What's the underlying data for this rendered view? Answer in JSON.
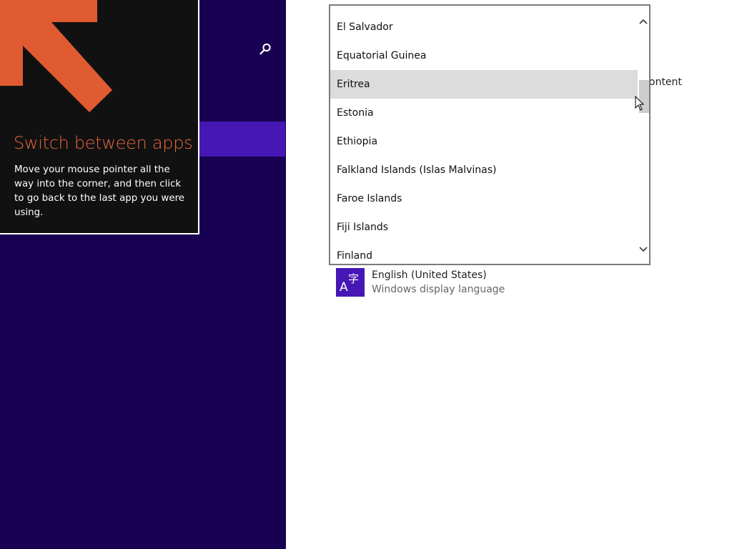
{
  "tip": {
    "title": "Switch between apps",
    "body": "Move your mouse pointer all the way into the corner, and then click to go back to the last app you were using."
  },
  "content": {
    "partial_text": "ontent",
    "language": {
      "name": "English (United States)",
      "subtitle": "Windows display language",
      "tile_glyph_a": "A",
      "tile_glyph_b": "字"
    }
  },
  "dropdown": {
    "items": [
      "El Salvador",
      "Equatorial Guinea",
      "Eritrea",
      "Estonia",
      "Ethiopia",
      "Falkland Islands (Islas Malvinas)",
      "Faroe Islands",
      "Fiji Islands",
      "Finland"
    ],
    "highlighted": "Eritrea"
  },
  "colors": {
    "left_pane": "#180052",
    "accent": "#4617b4",
    "tip_accent": "#e8663e"
  },
  "icons": {
    "search": "search-icon",
    "tip_arrow": "arrow-up-left-icon",
    "scroll_up": "chevron-up-icon",
    "scroll_down": "chevron-down-icon",
    "language": "language-icon",
    "cursor": "mouse-cursor-icon"
  }
}
